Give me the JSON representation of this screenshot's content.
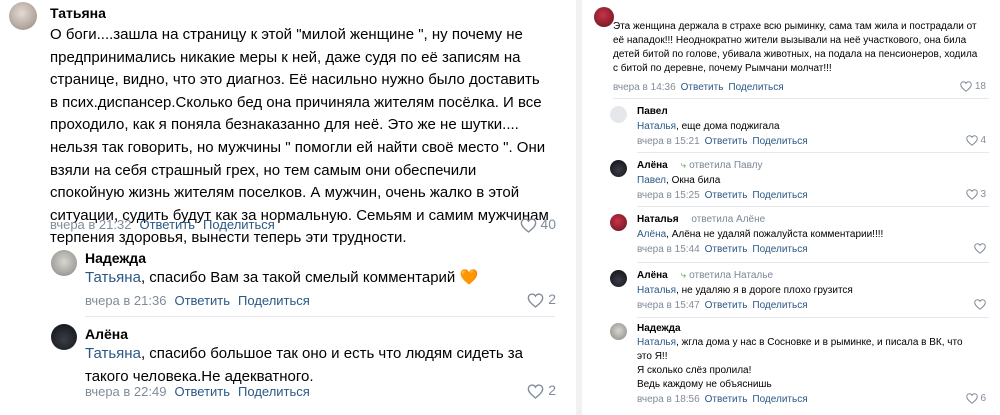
{
  "left": {
    "c1": {
      "author": "Татьяна",
      "text": "О боги....зашла на страницу к этой \"милой женщине \", ну почему не предпринимались никакие меры к ней, даже судя по её записям на странице, видно, что это диагноз. Её насильно нужно было доставить в псих.диспансер.Сколько бед она причиняла жителям посёлка. И все проходило, как я поняла безнаказанно для неё. Это же не шутки.... нельзя так говорить, но мужчины \" помогли ей найти своё место \". Они взяли на себя страшный грех, но тем самым они обеспечили спокойную жизнь жителям поселков. А мужчин, очень жалко в этой ситуации, судить будут как за нормальную. Семьям и самим мужчинам терпения здоровья, вынести теперь эти трудности.",
      "time": "вчера в 21:32",
      "reply_label": "Ответить",
      "share_label": "Поделиться",
      "likes": "40"
    },
    "c2": {
      "author": "Надежда",
      "addressee": "Татьяна",
      "text": ", спасибо Вам за такой смелый комментарий",
      "emoji": "🧡",
      "time": "вчера в 21:36",
      "reply_label": "Ответить",
      "share_label": "Поделиться",
      "likes": "2"
    },
    "c3": {
      "author": "Алёна",
      "addressee": "Татьяна",
      "text": ", спасибо большое так оно и есть что людям сидеть за такого человека.Не адекватного.",
      "time": "вчера в 22:49",
      "reply_label": "Ответить",
      "share_label": "Поделиться",
      "likes": "2"
    }
  },
  "right": {
    "r1": {
      "text": "Эта женщина держала в страхе всю рыминку, сама там жила и пострадали от её нападок!!! Неоднократно жители вызывали на неё участкового, она била детей битой по голове, убивала животных, на подала на пенсионеров, ходила с битой по деревне, почему Рымчани молчат!!!",
      "time": "вчера в 14:36",
      "reply_label": "Ответить",
      "share_label": "Поделиться",
      "likes": "18"
    },
    "r2": {
      "author": "Павел",
      "addressee": "Наталья",
      "text": ", еще дома поджигала",
      "time": "вчера в 15:21",
      "reply_label": "Ответить",
      "share_label": "Поделиться",
      "likes": "4"
    },
    "r3": {
      "author": "Алёна",
      "reply_note": "ответила Павлу",
      "addressee": "Павел",
      "text": ", Окна била",
      "time": "вчера в 15:25",
      "reply_label": "Ответить",
      "share_label": "Поделиться",
      "likes": "3"
    },
    "r4": {
      "author": "Наталья",
      "reply_note": "ответила Алёне",
      "addressee": "Алёна",
      "text": ", Алёна не удаляй пожалуйста комментарии!!!!",
      "time": "вчера в 15:44",
      "reply_label": "Ответить",
      "share_label": "Поделиться"
    },
    "r5": {
      "author": "Алёна",
      "reply_note": "ответила Наталье",
      "addressee": "Наталья",
      "text": ", не удаляю я в дороге плохо грузится",
      "time": "вчера в 15:47",
      "reply_label": "Ответить",
      "share_label": "Поделиться"
    },
    "r6": {
      "author": "Надежда",
      "addressee": "Наталья",
      "text_line1": ", жгла дома у нас в Сосновке и в рыминке, и писала в ВК, что это Я!!",
      "text_line2": "Я сколько слёз пролила!",
      "text_line3": "Ведь каждому не объяснишь",
      "time": "вчера в 18:56",
      "reply_label": "Ответить",
      "share_label": "Поделиться",
      "likes": "6"
    }
  }
}
